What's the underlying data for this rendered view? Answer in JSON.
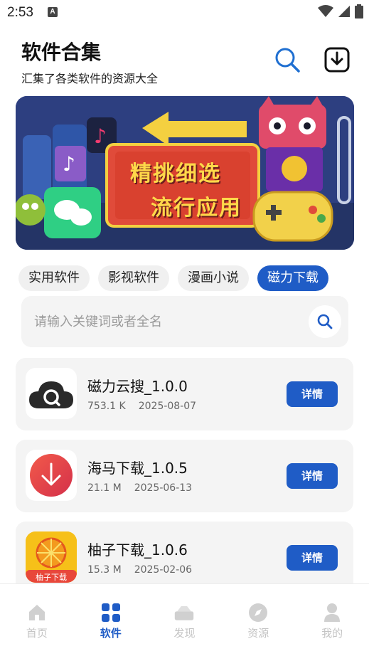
{
  "status_bar": {
    "time": "2:53",
    "notification_glyph": "A"
  },
  "header": {
    "title": "软件合集",
    "subtitle": "汇集了各类软件的资源大全"
  },
  "banner": {
    "line1": "精挑细选",
    "line2": "流行应用"
  },
  "tabs": [
    {
      "label": "实用软件",
      "active": false
    },
    {
      "label": "影视软件",
      "active": false
    },
    {
      "label": "漫画小说",
      "active": false
    },
    {
      "label": "磁力下载",
      "active": true
    }
  ],
  "search": {
    "placeholder": "请输入关键词或者全名"
  },
  "apps": [
    {
      "name": "磁力云搜_1.0.0",
      "size": "753.1 K",
      "date": "2025-08-07",
      "button": "详情"
    },
    {
      "name": "海马下载_1.0.5",
      "size": "21.1 M",
      "date": "2025-06-13",
      "button": "详情"
    },
    {
      "name": "柚子下载_1.0.6",
      "size": "15.3 M",
      "date": "2025-02-06",
      "button": "详情",
      "icon_caption": "柚子下载"
    }
  ],
  "nav": [
    {
      "label": "首页",
      "icon": "home-icon",
      "active": false
    },
    {
      "label": "软件",
      "icon": "grid-icon",
      "active": true
    },
    {
      "label": "发现",
      "icon": "discover-icon",
      "active": false
    },
    {
      "label": "资源",
      "icon": "compass-icon",
      "active": false
    },
    {
      "label": "我的",
      "icon": "user-icon",
      "active": false
    }
  ],
  "colors": {
    "accent": "#1f5cc6",
    "card_bg": "#f4f4f4",
    "nav_inactive": "#c4c4c4"
  }
}
